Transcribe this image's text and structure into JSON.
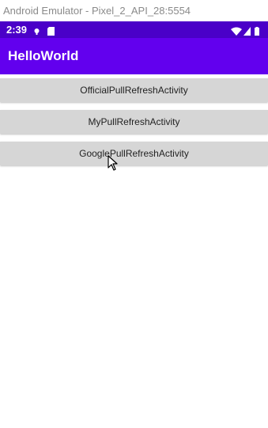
{
  "window": {
    "title": "Android Emulator - Pixel_2_API_28:5554"
  },
  "status_bar": {
    "time": "2:39",
    "icons": [
      "notification-dot-icon",
      "sd-card-icon",
      "wifi-icon",
      "signal-icon",
      "battery-icon"
    ],
    "color": "#4a00c8"
  },
  "app_bar": {
    "title": "HelloWorld",
    "color": "#6200ee"
  },
  "buttons": [
    {
      "label": "OfficialPullRefreshActivity"
    },
    {
      "label": "MyPullRefreshActivity"
    },
    {
      "label": "GooglePullRefreshActivity"
    }
  ],
  "colors": {
    "button_bg": "#d6d6d6",
    "background": "#ffffff"
  }
}
